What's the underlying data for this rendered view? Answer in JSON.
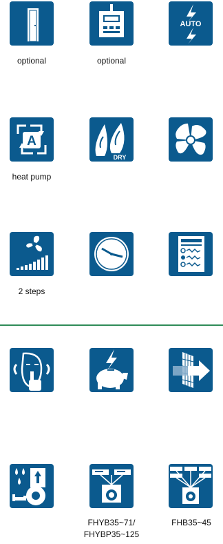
{
  "row1": {
    "icon1_caption": "optional",
    "icon2_caption": "optional",
    "icon3_text": "AUTO"
  },
  "row2": {
    "icon1_caption": "heat pump",
    "icon1_text": "A",
    "icon2_text": "DRY"
  },
  "row3": {
    "icon1_caption": "2 steps"
  },
  "row5": {
    "icon2_caption_line1": "FHYB35~71/",
    "icon2_caption_line2": "FHYBP35~125",
    "icon3_caption": "FHB35~45"
  },
  "colors": {
    "tile": "#0b5a8e",
    "divider": "#2e8b57"
  }
}
